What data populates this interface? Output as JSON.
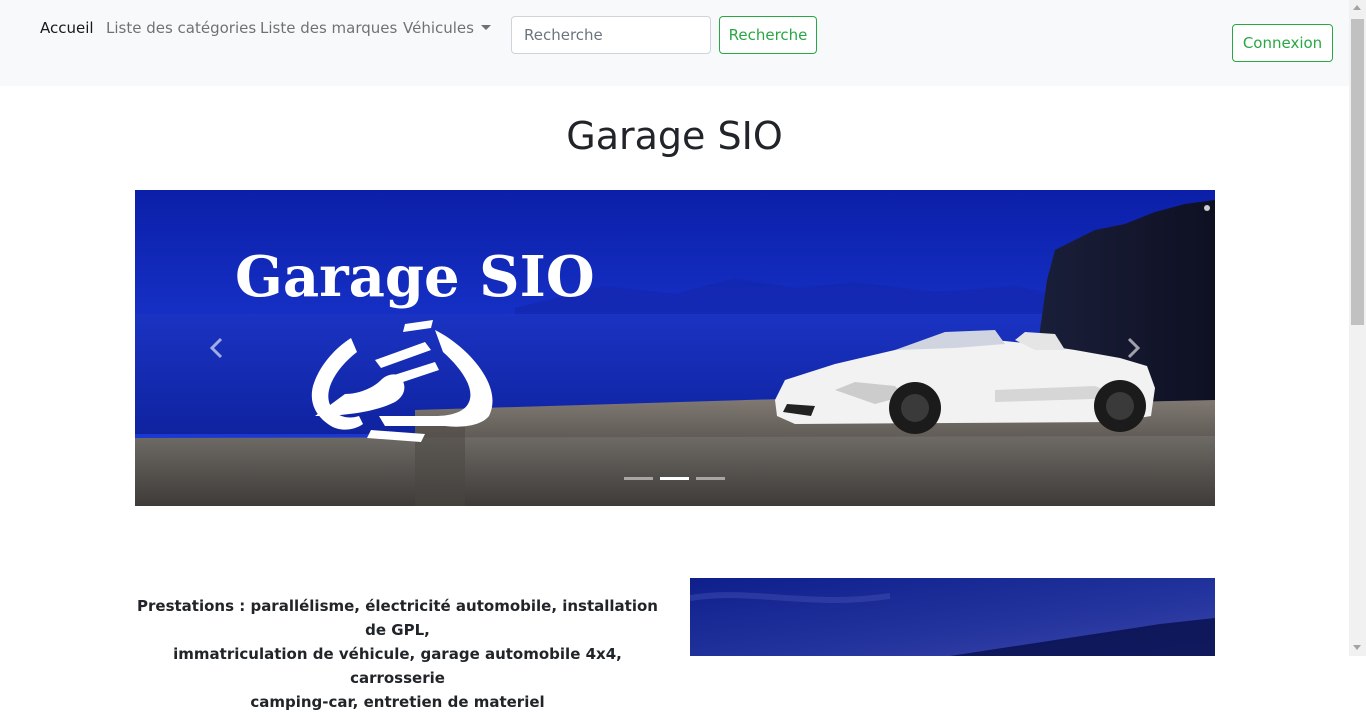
{
  "nav": {
    "items": [
      {
        "label": "Accueil",
        "active": true
      },
      {
        "label": "Liste des catégories",
        "active": false
      },
      {
        "label": "Liste des marques",
        "active": false
      },
      {
        "label": "Véhicules",
        "active": false,
        "dropdown": true
      }
    ],
    "search": {
      "placeholder": "Recherche",
      "value": "",
      "button_label": "Recherche"
    },
    "login_label": "Connexion"
  },
  "page": {
    "title": "Garage SIO"
  },
  "carousel": {
    "slide_logo_text": "Garage SIO",
    "indicators": 3,
    "active_index": 1,
    "prev_icon": "chevron-left-icon",
    "next_icon": "chevron-right-icon"
  },
  "services": {
    "lines": [
      "Prestations : parallélisme, électricité automobile, installation de GPL,",
      "immatriculation de véhicule, garage automobile 4x4, carrosserie",
      "camping-car, entretien de materiel"
    ]
  },
  "colors": {
    "accent": "#28a745",
    "navbar_bg": "#f8f9fa",
    "text": "#212529"
  }
}
